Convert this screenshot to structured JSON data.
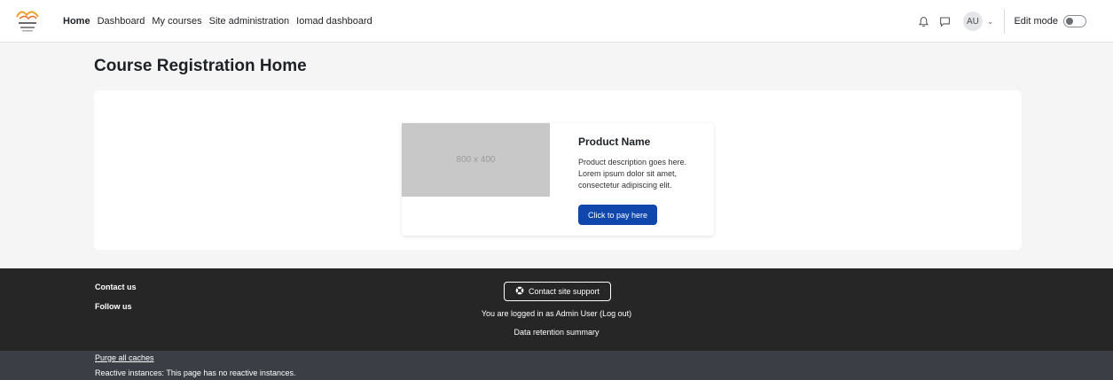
{
  "nav": {
    "links": [
      {
        "label": "Home",
        "active": true
      },
      {
        "label": "Dashboard",
        "active": false
      },
      {
        "label": "My courses",
        "active": false
      },
      {
        "label": "Site administration",
        "active": false
      },
      {
        "label": "Iomad dashboard",
        "active": false
      }
    ],
    "avatar_initials": "AU",
    "edit_mode_label": "Edit mode",
    "edit_mode_on": false
  },
  "page": {
    "title": "Course Registration Home"
  },
  "product": {
    "image_placeholder": "800 x 400",
    "name": "Product Name",
    "description": "Product description goes here. Lorem ipsum dolor sit amet, consectetur adipiscing elit.",
    "button_label": "Click to pay here"
  },
  "footer": {
    "contact_us": "Contact us",
    "follow_us": "Follow us",
    "support_button": "Contact site support",
    "logged_in_text": "You are logged in as Admin User (Log out)",
    "data_retention": "Data retention summary",
    "purge_caches": "Purge all caches",
    "reactive_instances": "Reactive instances: This page has no reactive instances."
  },
  "colors": {
    "primary": "#0f47ad",
    "footer_bg": "#262626",
    "dev_bg": "#3b3f45"
  },
  "icons": {
    "notification": "bell-icon",
    "messages": "chat-icon",
    "support": "lifebuoy-icon"
  }
}
